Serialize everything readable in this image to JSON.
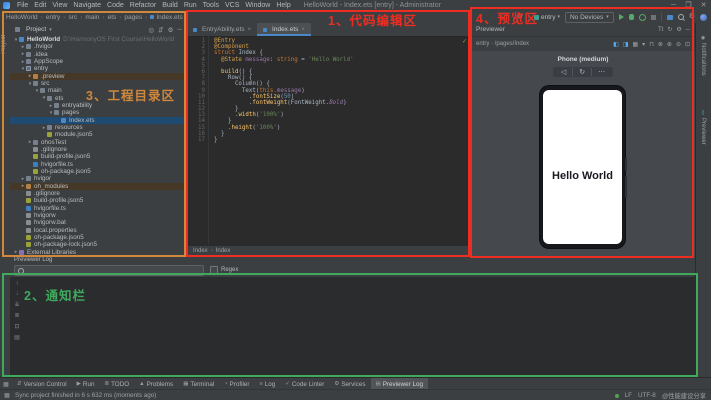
{
  "app": {
    "title": "HelloWorld - Index.ets [entry] - Administrator",
    "menus": [
      "File",
      "Edit",
      "View",
      "Navigate",
      "Code",
      "Refactor",
      "Build",
      "Run",
      "Tools",
      "VCS",
      "Window",
      "Help"
    ],
    "window_controls": [
      "─",
      "❐",
      "✕"
    ]
  },
  "toolbar": {
    "breadcrumb": [
      "HelloWorld",
      "entry",
      "src",
      "main",
      "ets",
      "pages",
      "Index.ets"
    ],
    "module_selector": "entry",
    "device_selector": "No Devices"
  },
  "project_panel": {
    "strip_label": "Project",
    "header_label": "Project",
    "header_caret": "▾",
    "header_icons": [
      "◎",
      "⇵",
      "⚙",
      "─"
    ],
    "tree": [
      {
        "l": "HelloWorld",
        "i": 0,
        "a": "v",
        "ic": "project",
        "root": true,
        "path": "D:\\HarmonyOS First Course\\HelloWorld"
      },
      {
        "l": ".hvigor",
        "i": 1,
        "a": ">",
        "ic": "folder"
      },
      {
        "l": ".idea",
        "i": 1,
        "a": ">",
        "ic": "folder"
      },
      {
        "l": "AppScope",
        "i": 1,
        "a": ">",
        "ic": "folder"
      },
      {
        "l": "entry",
        "i": 1,
        "a": "v",
        "ic": "module"
      },
      {
        "l": ".preview",
        "i": 2,
        "a": ">",
        "ic": "folder-ex",
        "hl": true
      },
      {
        "l": "src",
        "i": 2,
        "a": "v",
        "ic": "folder"
      },
      {
        "l": "main",
        "i": 3,
        "a": "v",
        "ic": "folder"
      },
      {
        "l": "ets",
        "i": 4,
        "a": "v",
        "ic": "folder"
      },
      {
        "l": "entryability",
        "i": 5,
        "a": ">",
        "ic": "folder"
      },
      {
        "l": "pages",
        "i": 5,
        "a": "v",
        "ic": "folder"
      },
      {
        "l": "Index.ets",
        "i": 6,
        "a": "",
        "ic": "ets",
        "sel": true
      },
      {
        "l": "resources",
        "i": 4,
        "a": ">",
        "ic": "folder"
      },
      {
        "l": "module.json5",
        "i": 4,
        "a": "",
        "ic": "json"
      },
      {
        "l": "ohosTest",
        "i": 2,
        "a": ">",
        "ic": "folder"
      },
      {
        "l": ".gitignore",
        "i": 2,
        "a": "",
        "ic": "file"
      },
      {
        "l": "build-profile.json5",
        "i": 2,
        "a": "",
        "ic": "json"
      },
      {
        "l": "hvigorfile.ts",
        "i": 2,
        "a": "",
        "ic": "ts"
      },
      {
        "l": "oh-package.json5",
        "i": 2,
        "a": "",
        "ic": "json"
      },
      {
        "l": "hvigor",
        "i": 1,
        "a": ">",
        "ic": "folder"
      },
      {
        "l": "oh_modules",
        "i": 1,
        "a": ">",
        "ic": "folder-ex",
        "hl": true
      },
      {
        "l": ".gitignore",
        "i": 1,
        "a": "",
        "ic": "file"
      },
      {
        "l": "build-profile.json5",
        "i": 1,
        "a": "",
        "ic": "json"
      },
      {
        "l": "hvigorfile.ts",
        "i": 1,
        "a": "",
        "ic": "ts"
      },
      {
        "l": "hvigorw",
        "i": 1,
        "a": "",
        "ic": "file"
      },
      {
        "l": "hvigorw.bat",
        "i": 1,
        "a": "",
        "ic": "file"
      },
      {
        "l": "local.properties",
        "i": 1,
        "a": "",
        "ic": "file"
      },
      {
        "l": "oh-package.json5",
        "i": 1,
        "a": "",
        "ic": "json"
      },
      {
        "l": "oh-package-lock.json5",
        "i": 1,
        "a": "",
        "ic": "json"
      },
      {
        "l": "External Libraries",
        "i": 0,
        "a": ">",
        "ic": "lib"
      }
    ]
  },
  "editor": {
    "tabs": [
      {
        "label": "EntryAbility.ets",
        "active": false
      },
      {
        "label": "Index.ets",
        "active": true
      }
    ],
    "close_glyph": "×",
    "inspection_check": "✓",
    "breadcrumb": [
      "Index",
      "Index"
    ],
    "lines": [
      {
        "n": 1,
        "s": [
          [
            "@Entry",
            "ann"
          ]
        ]
      },
      {
        "n": 2,
        "s": [
          [
            "@Component",
            "ann"
          ]
        ]
      },
      {
        "n": 3,
        "s": [
          [
            "struct",
            "kw"
          ],
          [
            " Index {",
            "plain"
          ]
        ]
      },
      {
        "n": 4,
        "s": [
          [
            "  @State",
            "ann"
          ],
          [
            " message",
            "field"
          ],
          [
            ": ",
            "plain"
          ],
          [
            "string",
            "kw"
          ],
          [
            " = ",
            "plain"
          ],
          [
            "'Hello World'",
            "str"
          ]
        ]
      },
      {
        "n": 5,
        "s": []
      },
      {
        "n": 6,
        "s": [
          [
            "  build",
            "fn"
          ],
          [
            "() {",
            "plain"
          ]
        ]
      },
      {
        "n": 7,
        "s": [
          [
            "    Row() {",
            "plain"
          ]
        ]
      },
      {
        "n": 8,
        "s": [
          [
            "      Column() {",
            "plain"
          ]
        ]
      },
      {
        "n": 9,
        "s": [
          [
            "        Text(",
            "plain"
          ],
          [
            "this",
            "kw"
          ],
          [
            ".message",
            "field"
          ],
          [
            ")",
            "plain"
          ]
        ]
      },
      {
        "n": 10,
        "s": [
          [
            "          .",
            "plain"
          ],
          [
            "fontSize",
            "fn"
          ],
          [
            "(",
            "plain"
          ],
          [
            "50",
            "num"
          ],
          [
            ")",
            "plain"
          ]
        ]
      },
      {
        "n": 11,
        "s": [
          [
            "          .",
            "plain"
          ],
          [
            "fontWeight",
            "fn"
          ],
          [
            "(FontWeight.",
            "plain"
          ],
          [
            "Bold",
            "const"
          ],
          [
            ")",
            "plain"
          ]
        ]
      },
      {
        "n": 12,
        "s": [
          [
            "      }",
            "plain"
          ]
        ]
      },
      {
        "n": 13,
        "s": [
          [
            "      .",
            "plain"
          ],
          [
            "width",
            "fn"
          ],
          [
            "(",
            "plain"
          ],
          [
            "'100%'",
            "str"
          ],
          [
            ")",
            "plain"
          ]
        ]
      },
      {
        "n": 14,
        "s": [
          [
            "    }",
            "plain"
          ]
        ]
      },
      {
        "n": 15,
        "s": [
          [
            "    .",
            "plain"
          ],
          [
            "height",
            "fn"
          ],
          [
            "(",
            "plain"
          ],
          [
            "'100%'",
            "str"
          ],
          [
            ")",
            "plain"
          ]
        ]
      },
      {
        "n": 16,
        "s": [
          [
            "  }",
            "plain"
          ]
        ]
      },
      {
        "n": 17,
        "s": [
          [
            "}",
            "plain"
          ]
        ]
      }
    ]
  },
  "preview": {
    "panel_title": "Previewer",
    "header_icons": [
      "Tt",
      "↻",
      "⚙",
      "─"
    ],
    "path": "entry · /pages/Index",
    "toolbar_icons": [
      {
        "g": "◧",
        "blue": true
      },
      {
        "g": "◨",
        "blue": true
      },
      {
        "g": "▦",
        "blue": false
      },
      {
        "g": "▾",
        "blue": false
      },
      {
        "g": "⊓",
        "blue": false
      },
      {
        "g": "⊗",
        "blue": false
      },
      {
        "g": "⊕",
        "blue": false
      },
      {
        "g": "⊖",
        "blue": false
      },
      {
        "g": "⊡",
        "blue": false
      }
    ],
    "device_label": "Phone (medium)",
    "device_buttons": [
      "◁",
      "↻",
      "⋯"
    ],
    "screen_text": "Hello World"
  },
  "right_strip": {
    "tabs": [
      {
        "icon": "◉",
        "label": "Notifications"
      },
      {
        "icon": "▯",
        "label": "Previewer"
      }
    ]
  },
  "log_panel": {
    "title": "Previewer Log",
    "regex_label": "Regex",
    "strip_icons": [
      "↑",
      "↓",
      "⇊",
      "≣",
      "⊡",
      "▤"
    ]
  },
  "bottom_bar": {
    "items": [
      {
        "icon": "⇵",
        "label": "Version Control",
        "active": false
      },
      {
        "icon": "▶",
        "label": "Run",
        "active": false
      },
      {
        "icon": "≣",
        "label": "TODO",
        "active": false
      },
      {
        "icon": "▲",
        "label": "Problems",
        "active": false
      },
      {
        "icon": "▦",
        "label": "Terminal",
        "active": false
      },
      {
        "icon": "◔",
        "label": "Profiler",
        "active": false
      },
      {
        "icon": "≡",
        "label": "Log",
        "active": false
      },
      {
        "icon": "✓",
        "label": "Code Linter",
        "active": false
      },
      {
        "icon": "⚙",
        "label": "Services",
        "active": false
      },
      {
        "icon": "▤",
        "label": "Previewer Log",
        "active": true
      }
    ]
  },
  "status_bar": {
    "sync_message": "Sync project finished in 6 s 632 ms (moments ago)",
    "right_tokens": [
      "LF",
      "UTF-8"
    ],
    "watermark": "@性能建设分享"
  },
  "annotations": [
    {
      "label": "1、代码编辑区",
      "color": "#ee2d22"
    },
    {
      "label": "2、通知栏",
      "color": "#3fa95c"
    },
    {
      "label": "3、工程目录区",
      "color": "#d0883c"
    },
    {
      "label": "4、预览区",
      "color": "#ee2d22"
    }
  ]
}
